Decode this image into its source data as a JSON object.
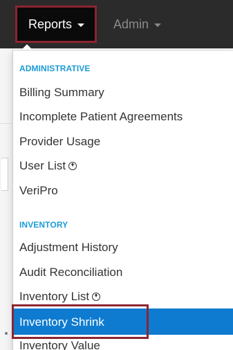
{
  "nav": {
    "reports_label": "Reports",
    "admin_label": "Admin"
  },
  "menu": {
    "sections": [
      {
        "header": "ADMINISTRATIVE",
        "items": [
          {
            "label": "Billing Summary"
          },
          {
            "label": "Incomplete Patient Agreements"
          },
          {
            "label": "Provider Usage"
          },
          {
            "label": "User List",
            "icon": "download-icon"
          },
          {
            "label": "VeriPro"
          }
        ]
      },
      {
        "header": "INVENTORY",
        "items": [
          {
            "label": "Adjustment History"
          },
          {
            "label": "Audit Reconciliation"
          },
          {
            "label": "Inventory List",
            "icon": "download-icon"
          },
          {
            "label": "Inventory Shrink",
            "active": true
          },
          {
            "label": "Inventory Value"
          }
        ]
      }
    ]
  },
  "colors": {
    "navbar": "#2b2b2b",
    "highlight_frame": "#8c2430",
    "section_header": "#1a9bd6",
    "active_item_bg": "#0e7bd0"
  }
}
